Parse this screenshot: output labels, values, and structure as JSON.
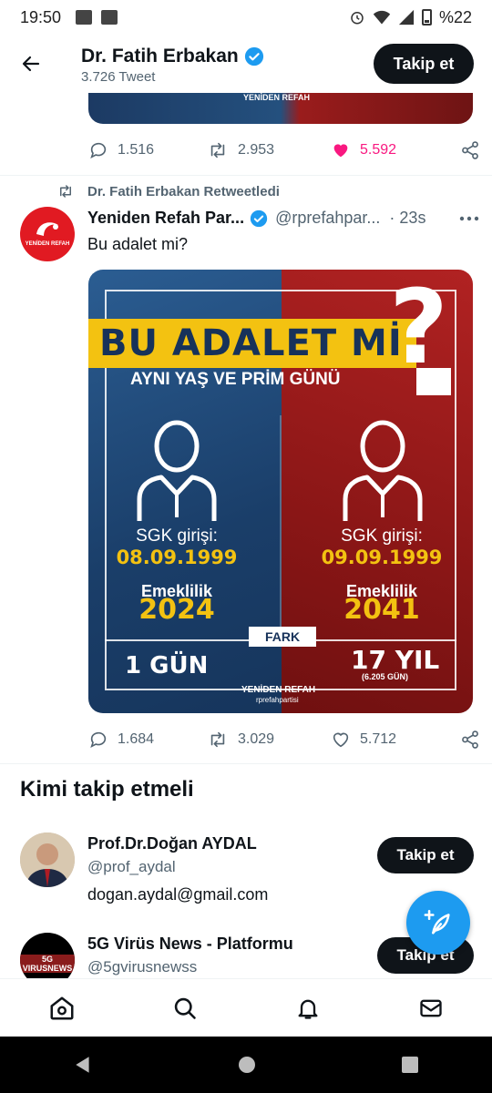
{
  "status_bar": {
    "time": "19:50",
    "battery": "%22"
  },
  "header": {
    "name": "Dr. Fatih Erbakan",
    "tweet_count": "3.726 Tweet",
    "follow_label": "Takip et"
  },
  "prev_tweet": {
    "image_brand": "YENİDEN REFAH",
    "replies": "1.516",
    "retweets": "2.953",
    "likes": "5.592"
  },
  "tweet": {
    "retweeted_by": "Dr. Fatih Erbakan Retweetledi",
    "author_name": "Yeniden Refah Par...",
    "handle": "@rprefahpar...",
    "time": "· 23s",
    "text": "Bu adalet mi?",
    "avatar_label": "YENİDEN REFAH",
    "image": {
      "title": "BU ADALET Mİ",
      "question_mark": "?",
      "subtitle": "AYNI YAŞ VE PRİM GÜNÜ",
      "left": {
        "sgk_label": "SGK girişi:",
        "sgk_date": "08.09.1999",
        "retire_label": "Emeklilik",
        "retire_year": "2024"
      },
      "right": {
        "sgk_label": "SGK girişi:",
        "sgk_date": "09.09.1999",
        "retire_label": "Emeklilik",
        "retire_year": "2041"
      },
      "diff_label": "FARK",
      "diff_left": "1 GÜN",
      "diff_right": "17 YIL",
      "diff_right_sub": "(6.205 GÜN)",
      "brand": "YENİDEN REFAH",
      "brand_handle": "rprefahpartisi"
    },
    "replies": "1.684",
    "retweets": "3.029",
    "likes": "5.712"
  },
  "who_to_follow": {
    "title": "Kimi takip etmeli",
    "items": [
      {
        "name": "Prof.Dr.Doğan AYDAL",
        "handle": "@prof_aydal",
        "bio": "dogan.aydal@gmail.com",
        "button": "Takip et"
      },
      {
        "name": "5G Virüs News - Platformu",
        "handle": "@5gvirusnewss",
        "bio": "",
        "button": "Takip et",
        "avatar_text": "5G VIRUSNEWS"
      }
    ]
  },
  "icons": {
    "back": "arrow-left-icon",
    "verified": "verified-badge-icon",
    "reply": "reply-icon",
    "retweet": "retweet-icon",
    "like": "heart-icon",
    "share": "share-icon",
    "more": "more-icon",
    "compose": "compose-icon",
    "home": "home-icon",
    "search": "search-icon",
    "notifications": "bell-icon",
    "messages": "mail-icon"
  },
  "colors": {
    "accent": "#1d9bf0",
    "liked": "#f91880",
    "follow_button": "#0f1419",
    "poster_yellow": "#f3c211"
  }
}
